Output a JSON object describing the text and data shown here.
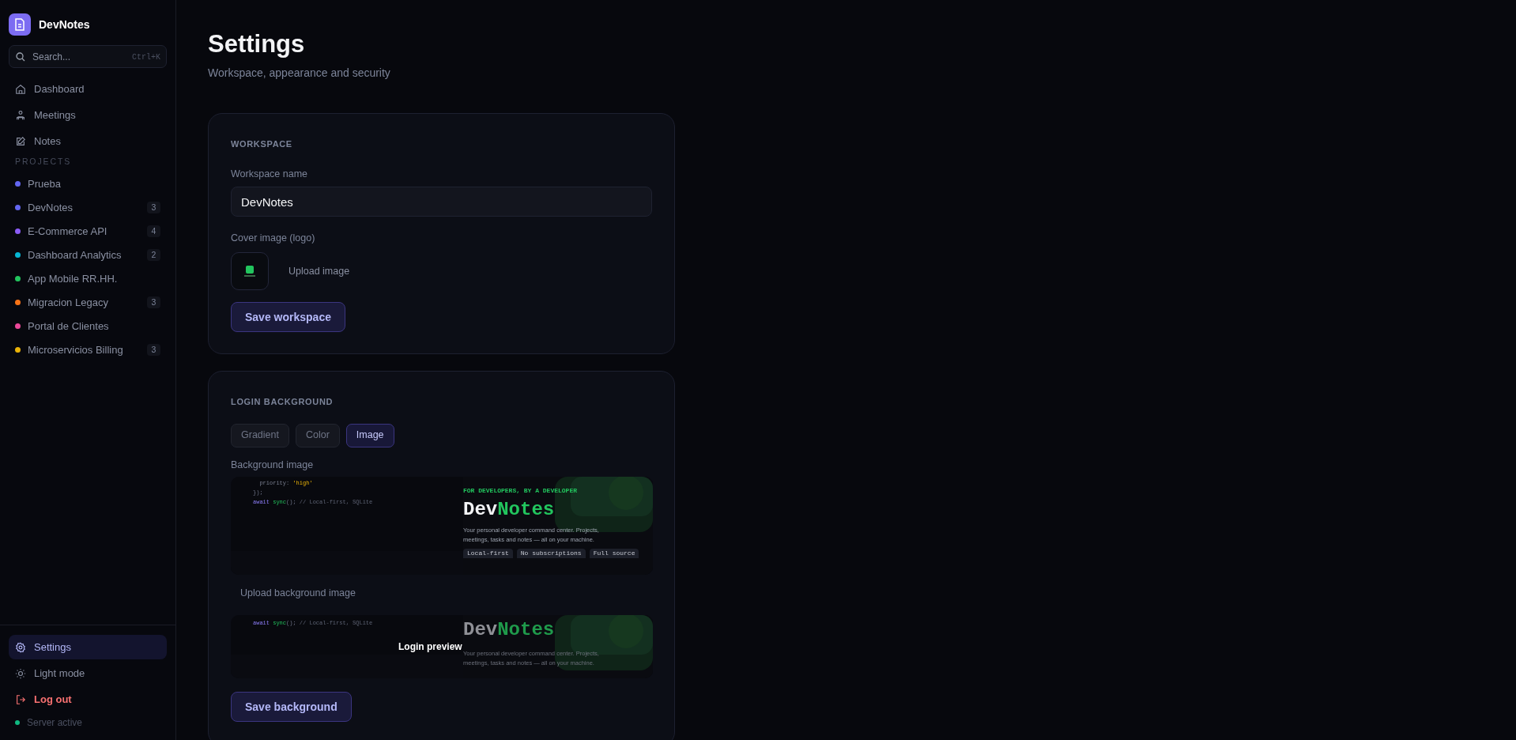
{
  "app": {
    "name": "DevNotes"
  },
  "search": {
    "placeholder": "Search...",
    "shortcut": "Ctrl+K"
  },
  "nav": [
    {
      "kind": "home",
      "label": "Dashboard",
      "selected": false
    },
    {
      "kind": "people",
      "label": "Meetings",
      "selected": false
    },
    {
      "kind": "edit",
      "label": "Notes",
      "selected": false
    }
  ],
  "projects_heading": "PROJECTS",
  "projects": [
    {
      "name": "Prueba",
      "color": "#6366f1"
    },
    {
      "name": "DevNotes",
      "color": "#6366f1",
      "count": "3"
    },
    {
      "name": "E-Commerce API",
      "color": "#8b5cf6",
      "count": "4"
    },
    {
      "name": "Dashboard Analytics",
      "color": "#06b6d4",
      "count": "2"
    },
    {
      "name": "App Mobile RR.HH.",
      "color": "#22c55e"
    },
    {
      "name": "Migracion Legacy",
      "color": "#f97316",
      "count": "3"
    },
    {
      "name": "Portal de Clientes",
      "color": "#ec4899"
    },
    {
      "name": "Microservicios Billing",
      "color": "#eab308",
      "count": "3"
    }
  ],
  "bottom_nav": [
    {
      "kind": "settings",
      "label": "Settings",
      "selected": true
    },
    {
      "kind": "theme",
      "label": "Light mode",
      "selected": false
    },
    {
      "kind": "logout",
      "label": "Log out",
      "selected": false
    }
  ],
  "server_status": {
    "label": "Server active",
    "online": true
  },
  "page": {
    "title": "Settings",
    "subtitle": "Workspace, appearance and security"
  },
  "workspace_card": {
    "heading": "WORKSPACE",
    "name_label": "Workspace name",
    "name_value": "DevNotes",
    "cover_label": "Cover image (logo)",
    "upload_label": "Upload image",
    "save_label": "Save workspace"
  },
  "background_card": {
    "heading": "LOGIN BACKGROUND",
    "modes": [
      {
        "label": "Gradient",
        "selected": false
      },
      {
        "label": "Color",
        "selected": false
      },
      {
        "label": "Image",
        "selected": true
      }
    ],
    "image_label": "Background image",
    "image_preview": {
      "code_lines": [
        [
          {
            "kind": "key",
            "text": "  priority: "
          },
          {
            "kind": "string",
            "text": "'high'"
          }
        ],
        [
          {
            "kind": "punct",
            "text": "});"
          }
        ],
        [
          {
            "kind": "keyword",
            "text": "await "
          },
          {
            "kind": "fn",
            "text": "sync"
          },
          {
            "kind": "punct",
            "text": "(); "
          },
          {
            "kind": "comment",
            "text": "// Local-first, SQLite"
          }
        ]
      ],
      "tagline": "FOR DEVELOPERS, BY A DEVELOPER",
      "brand_first": "Dev",
      "brand_second": "Notes",
      "description": "Your personal developer command center. Projects, meetings, tasks and notes — all on your machine.",
      "tags": [
        "Local-first",
        "No subscriptions",
        "Full source"
      ]
    },
    "upload_label": "Upload background image",
    "login_preview": {
      "code_lines": [
        [
          {
            "kind": "keyword",
            "text": "await "
          },
          {
            "kind": "fn",
            "text": "sync"
          },
          {
            "kind": "punct",
            "text": "(); "
          },
          {
            "kind": "comment",
            "text": "// Local-first, SQLite"
          }
        ]
      ],
      "brand_first": "Dev",
      "brand_second": "Notes",
      "description": "Your personal developer command center. Projects, meetings, tasks and notes — all on your machine.",
      "overlay_label": "Login preview"
    },
    "save_label": "Save background"
  }
}
